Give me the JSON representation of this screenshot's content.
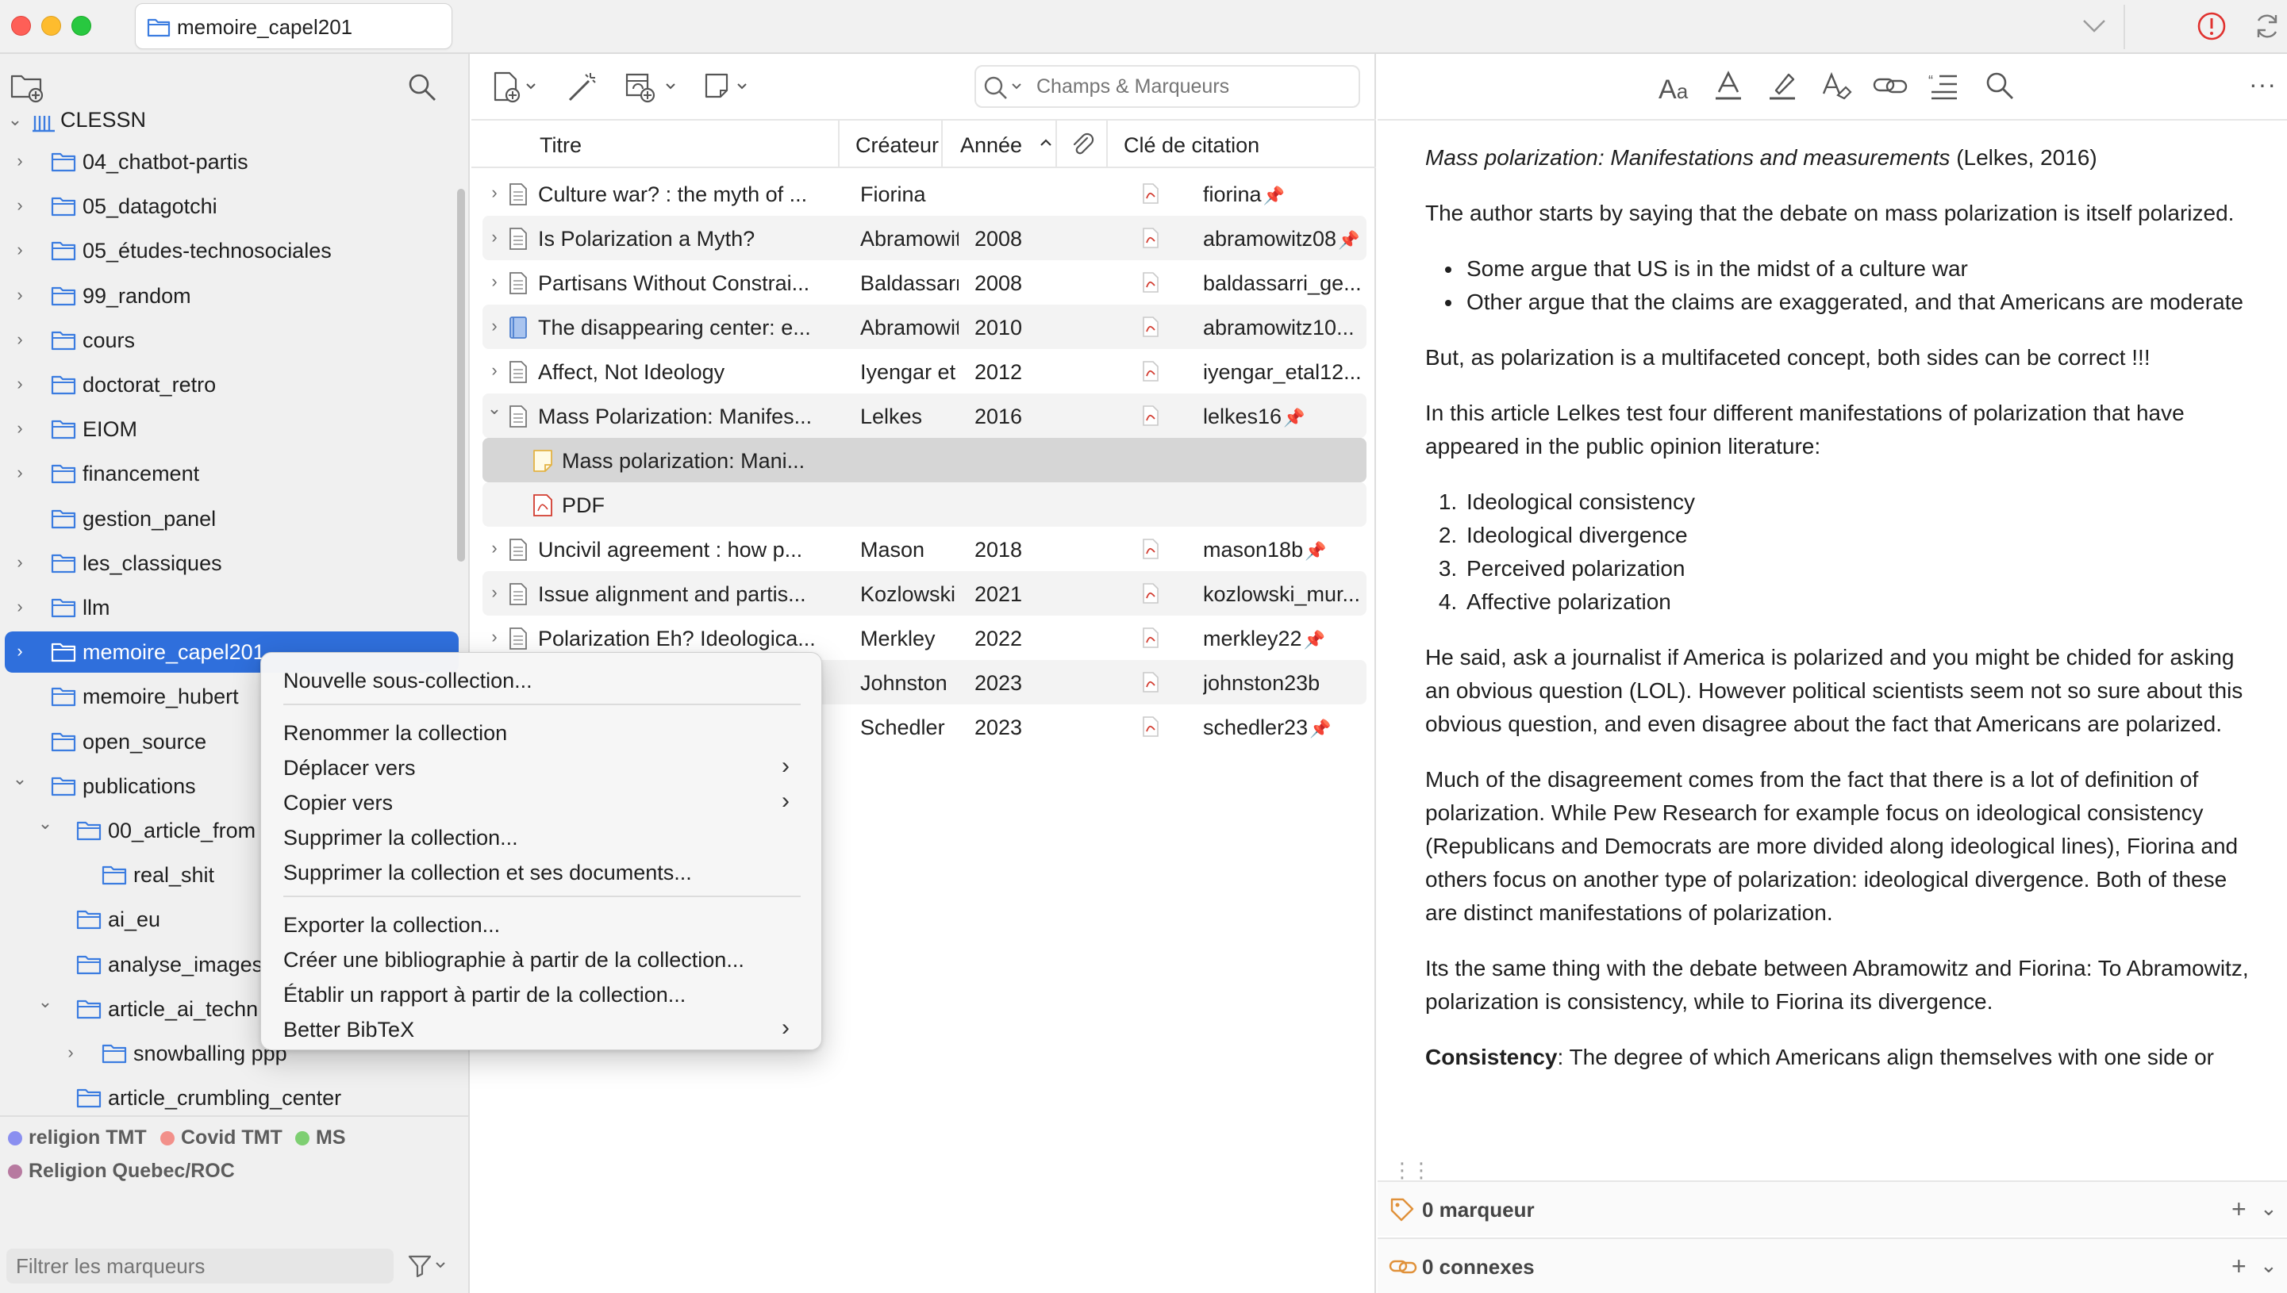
{
  "window": {
    "tab_title": "memoire_capel201"
  },
  "sidebar": {
    "library_root": "CLESSN",
    "items": [
      {
        "label": "04_chatbot-partis",
        "expanded": false,
        "chevron": true,
        "level": 1
      },
      {
        "label": "05_datagotchi",
        "expanded": false,
        "chevron": true,
        "level": 1
      },
      {
        "label": "05_études-technosociales",
        "expanded": false,
        "chevron": true,
        "level": 1
      },
      {
        "label": "99_random",
        "expanded": false,
        "chevron": true,
        "level": 1
      },
      {
        "label": "cours",
        "expanded": false,
        "chevron": true,
        "level": 1
      },
      {
        "label": "doctorat_retro",
        "expanded": false,
        "chevron": true,
        "level": 1
      },
      {
        "label": "EIOM",
        "expanded": false,
        "chevron": true,
        "level": 1
      },
      {
        "label": "financement",
        "expanded": false,
        "chevron": true,
        "level": 1
      },
      {
        "label": "gestion_panel",
        "expanded": false,
        "chevron": false,
        "level": 1
      },
      {
        "label": "les_classiques",
        "expanded": false,
        "chevron": true,
        "level": 1
      },
      {
        "label": "llm",
        "expanded": false,
        "chevron": true,
        "level": 1
      },
      {
        "label": "memoire_capel201",
        "expanded": false,
        "chevron": true,
        "level": 1,
        "selected": true
      },
      {
        "label": "memoire_hubert",
        "expanded": false,
        "chevron": false,
        "level": 1
      },
      {
        "label": "open_source",
        "expanded": false,
        "chevron": false,
        "level": 1
      },
      {
        "label": "publications",
        "expanded": true,
        "chevron": true,
        "level": 1
      },
      {
        "label": "00_article_from",
        "expanded": true,
        "chevron": true,
        "level": 2
      },
      {
        "label": "real_shit",
        "expanded": false,
        "chevron": false,
        "level": 3
      },
      {
        "label": "ai_eu",
        "expanded": false,
        "chevron": false,
        "level": 2
      },
      {
        "label": "analyse_images",
        "expanded": false,
        "chevron": false,
        "level": 2
      },
      {
        "label": "article_ai_techn",
        "expanded": true,
        "chevron": true,
        "level": 2
      },
      {
        "label": "snowballing ppp",
        "expanded": false,
        "chevron": true,
        "level": 3
      },
      {
        "label": "article_crumbling_center",
        "expanded": false,
        "chevron": false,
        "level": 2
      }
    ],
    "tags": [
      {
        "label": "religion TMT",
        "color": "#8a8ff0"
      },
      {
        "label": "Covid TMT",
        "color": "#f2908a"
      },
      {
        "label": "MS",
        "color": "#7ecf72"
      },
      {
        "label": "Religion Quebec/ROC",
        "color": "#b77aa0"
      }
    ],
    "filter_placeholder": "Filtrer les marqueurs"
  },
  "middle": {
    "search_placeholder": "Champs & Marqueurs",
    "columns": {
      "title": "Titre",
      "creator": "Créateur",
      "year": "Année",
      "citekey": "Clé de citation"
    },
    "rows": [
      {
        "title": "Culture war? : the myth of ...",
        "creator": "Fiorina",
        "year": "",
        "citekey": "fiorina",
        "pinned": true,
        "type": "doc",
        "chevron": "right"
      },
      {
        "title": "Is Polarization a Myth?",
        "creator": "Abramowitz ...",
        "year": "2008",
        "citekey": "abramowitz08",
        "pinned": true,
        "type": "doc",
        "chevron": "right"
      },
      {
        "title": "Partisans Without Constrai...",
        "creator": "Baldassarri ...",
        "year": "2008",
        "citekey": "baldassarri_ge...",
        "pinned": false,
        "type": "doc",
        "chevron": "right"
      },
      {
        "title": "The disappearing center: e...",
        "creator": "Abramowitz",
        "year": "2010",
        "citekey": "abramowitz10...",
        "pinned": false,
        "type": "book",
        "chevron": "right"
      },
      {
        "title": "Affect, Not Ideology",
        "creator": "Iyengar et al.",
        "year": "2012",
        "citekey": "iyengar_etal12...",
        "pinned": false,
        "type": "doc",
        "chevron": "right"
      },
      {
        "title": "Mass Polarization: Manifes...",
        "creator": "Lelkes",
        "year": "2016",
        "citekey": "lelkes16",
        "pinned": true,
        "type": "doc",
        "chevron": "down"
      },
      {
        "title": "Mass polarization: Mani...",
        "creator": "",
        "year": "",
        "citekey": "",
        "pinned": false,
        "type": "note",
        "chevron": "none",
        "child": true,
        "selected": true
      },
      {
        "title": "PDF",
        "creator": "",
        "year": "",
        "citekey": "",
        "pinned": false,
        "type": "pdf",
        "chevron": "none",
        "child": true
      },
      {
        "title": "Uncivil agreement : how p...",
        "creator": "Mason",
        "year": "2018",
        "citekey": "mason18b",
        "pinned": true,
        "type": "doc",
        "chevron": "right"
      },
      {
        "title": "Issue alignment and partis...",
        "creator": "Kozlowski et...",
        "year": "2021",
        "citekey": "kozlowski_mur...",
        "pinned": false,
        "type": "doc",
        "chevron": "right"
      },
      {
        "title": "Polarization Eh? Ideologica...",
        "creator": "Merkley",
        "year": "2022",
        "citekey": "merkley22",
        "pinned": true,
        "type": "doc",
        "chevron": "right"
      },
      {
        "title": "",
        "creator": "Johnston",
        "year": "2023",
        "citekey": "johnston23b",
        "pinned": false,
        "type": "doc",
        "chevron": "none"
      },
      {
        "title": "",
        "creator": "Schedler",
        "year": "2023",
        "citekey": "schedler23",
        "pinned": true,
        "type": "doc",
        "chevron": "none"
      }
    ]
  },
  "note": {
    "title_italic": "Mass polarization: Manifestations and measurements",
    "title_suffix": " (Lelkes, 2016)",
    "p1": "The author starts by saying that the debate on mass polarization is itself polarized.",
    "bullets": [
      "Some argue that US is in the midst of a culture war",
      "Other argue that the claims are exaggerated, and that Americans are moderate"
    ],
    "p2": "But, as polarization is a multifaceted concept, both sides can be correct !!!",
    "p3": "In this article Lelkes test four different manifestations of polarization that have appeared in the public opinion literature:",
    "numbered": [
      "Ideological consistency",
      "Ideological divergence",
      "Perceived polarization",
      "Affective polarization"
    ],
    "p4": "He said, ask a journalist if America is polarized and you might be chided for asking an obvious question (LOL). However political scientists seem not so sure about this obvious question, and even disagree about the fact that Americans are polarized.",
    "p5": "Much of the disagreement comes from the fact that there is a lot of definition of polarization. While Pew Research for example focus on ideological consistency (Republicans and Democrats are more divided along ideological lines), Fiorina and others focus on another type of polarization: ideological divergence. Both of these are distinct manifestations of polarization.",
    "p6": "Its the same thing with the debate between Abramowitz and Fiorina: To Abramowitz, polarization is consistency, while to Fiorina its divergence.",
    "p7_bold": "Consistency",
    "p7_rest": ": The degree of which Americans align themselves with one side or",
    "tags_footer": "0 marqueur",
    "related_footer": "0 connexes"
  },
  "context_menu": {
    "items": [
      {
        "label": "Nouvelle sous-collection...",
        "submenu": false
      },
      {
        "label": "Renommer la collection",
        "submenu": false
      },
      {
        "label": "Déplacer vers",
        "submenu": true
      },
      {
        "label": "Copier vers",
        "submenu": true
      },
      {
        "label": "Supprimer la collection...",
        "submenu": false
      },
      {
        "label": "Supprimer la collection et ses documents...",
        "submenu": false
      },
      {
        "label": "Exporter la collection...",
        "submenu": false
      },
      {
        "label": "Créer une bibliographie à partir de la collection...",
        "submenu": false
      },
      {
        "label": "Établir un rapport à partir de la collection...",
        "submenu": false
      },
      {
        "label": "Better BibTeX",
        "submenu": true
      }
    ]
  },
  "colors": {
    "accent": "#2f6fdc",
    "folder_icon": "#3b7ce0",
    "pin": "#e0413a",
    "pdf_icon": "#d23b2f",
    "error_icon": "#e0322f"
  }
}
